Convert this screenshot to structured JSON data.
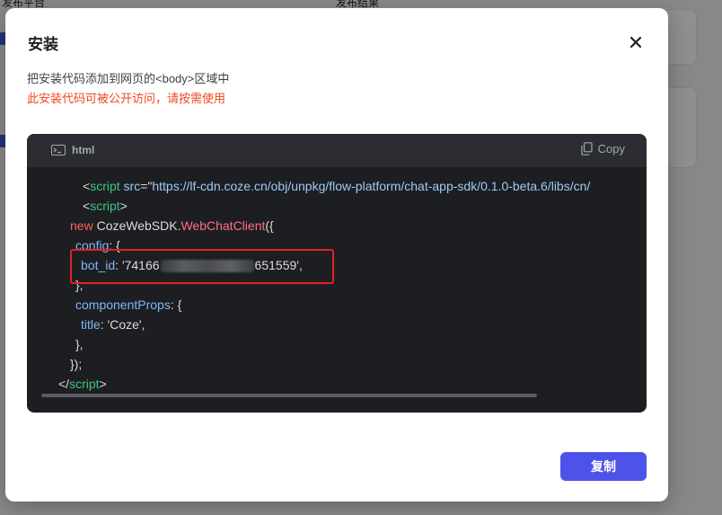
{
  "background": {
    "label_left": "发布平台",
    "label_right": "发布结果"
  },
  "modal": {
    "title": "安装",
    "close_icon": "close-icon",
    "description": "把安装代码添加到网页的<body>区域中",
    "warning": "此安装代码可被公开访问，请按需使用",
    "warning_color": "#f0461e",
    "code_block": {
      "language": "html",
      "copy_label": "Copy",
      "lines": {
        "l1_open": "<",
        "l1_tag": "script",
        "l1_attr": " src",
        "l1_eq": "=\"",
        "l1_url": "https://lf-cdn.coze.cn/obj/unpkg/flow-platform/chat-app-sdk/0.1.0-beta.6/libs/cn/",
        "l2_open": "<",
        "l2_tag": "script",
        "l2_close": ">",
        "l3_new": "new",
        "l3_cls": " CozeWebSDK.",
        "l3_method": "WebChatClient",
        "l3_punct": "({",
        "l4_prop": "config",
        "l4_punct": ": {",
        "l5_prop": "bot_id",
        "l5_colon": ": ",
        "l5_val_start": "'74166",
        "l5_val_end": "651559'",
        "l5_punct": ",",
        "l6": "},",
        "l7_prop": "componentProps",
        "l7_punct": ": {",
        "l8_prop": "title",
        "l8_colon": ": ",
        "l8_val": "'Coze'",
        "l8_punct": ",",
        "l9": "},",
        "l10": "});",
        "l11_open": "</",
        "l11_tag": "script",
        "l11_close": ">"
      }
    },
    "primary_button": "复制",
    "primary_color": "#4d53e8"
  }
}
